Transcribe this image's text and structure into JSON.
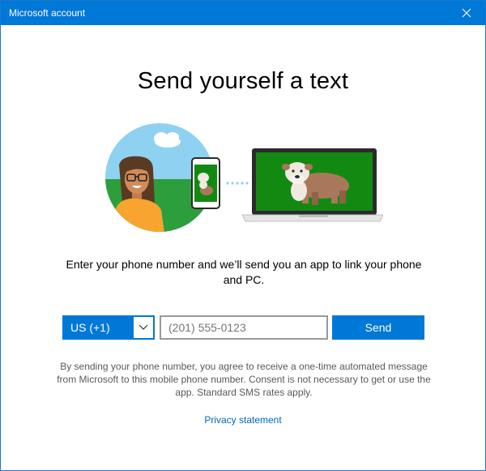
{
  "window": {
    "title": "Microsoft account",
    "close_icon": "close-icon"
  },
  "main": {
    "heading": "Send yourself a text",
    "description": "Enter your phone number and we’ll send you an app to link your phone and PC.",
    "illustration_icons": [
      "person-avatar",
      "phone-icon",
      "laptop-icon",
      "dog-image"
    ],
    "country_select": {
      "selected": "US (+1)",
      "icon": "chevron-down-icon"
    },
    "phone_input": {
      "value": "",
      "placeholder": "(201) 555-0123"
    },
    "send_label": "Send",
    "disclaimer": "By sending your phone number, you agree to receive a one-time automated message from Microsoft to this mobile phone number. Consent is not necessary to get or use the app. Standard SMS rates apply.",
    "privacy_label": "Privacy statement"
  },
  "colors": {
    "accent": "#0078d7",
    "link": "#0067b8",
    "disclaimer_text": "#595959",
    "illustration_green": "#128a12"
  }
}
